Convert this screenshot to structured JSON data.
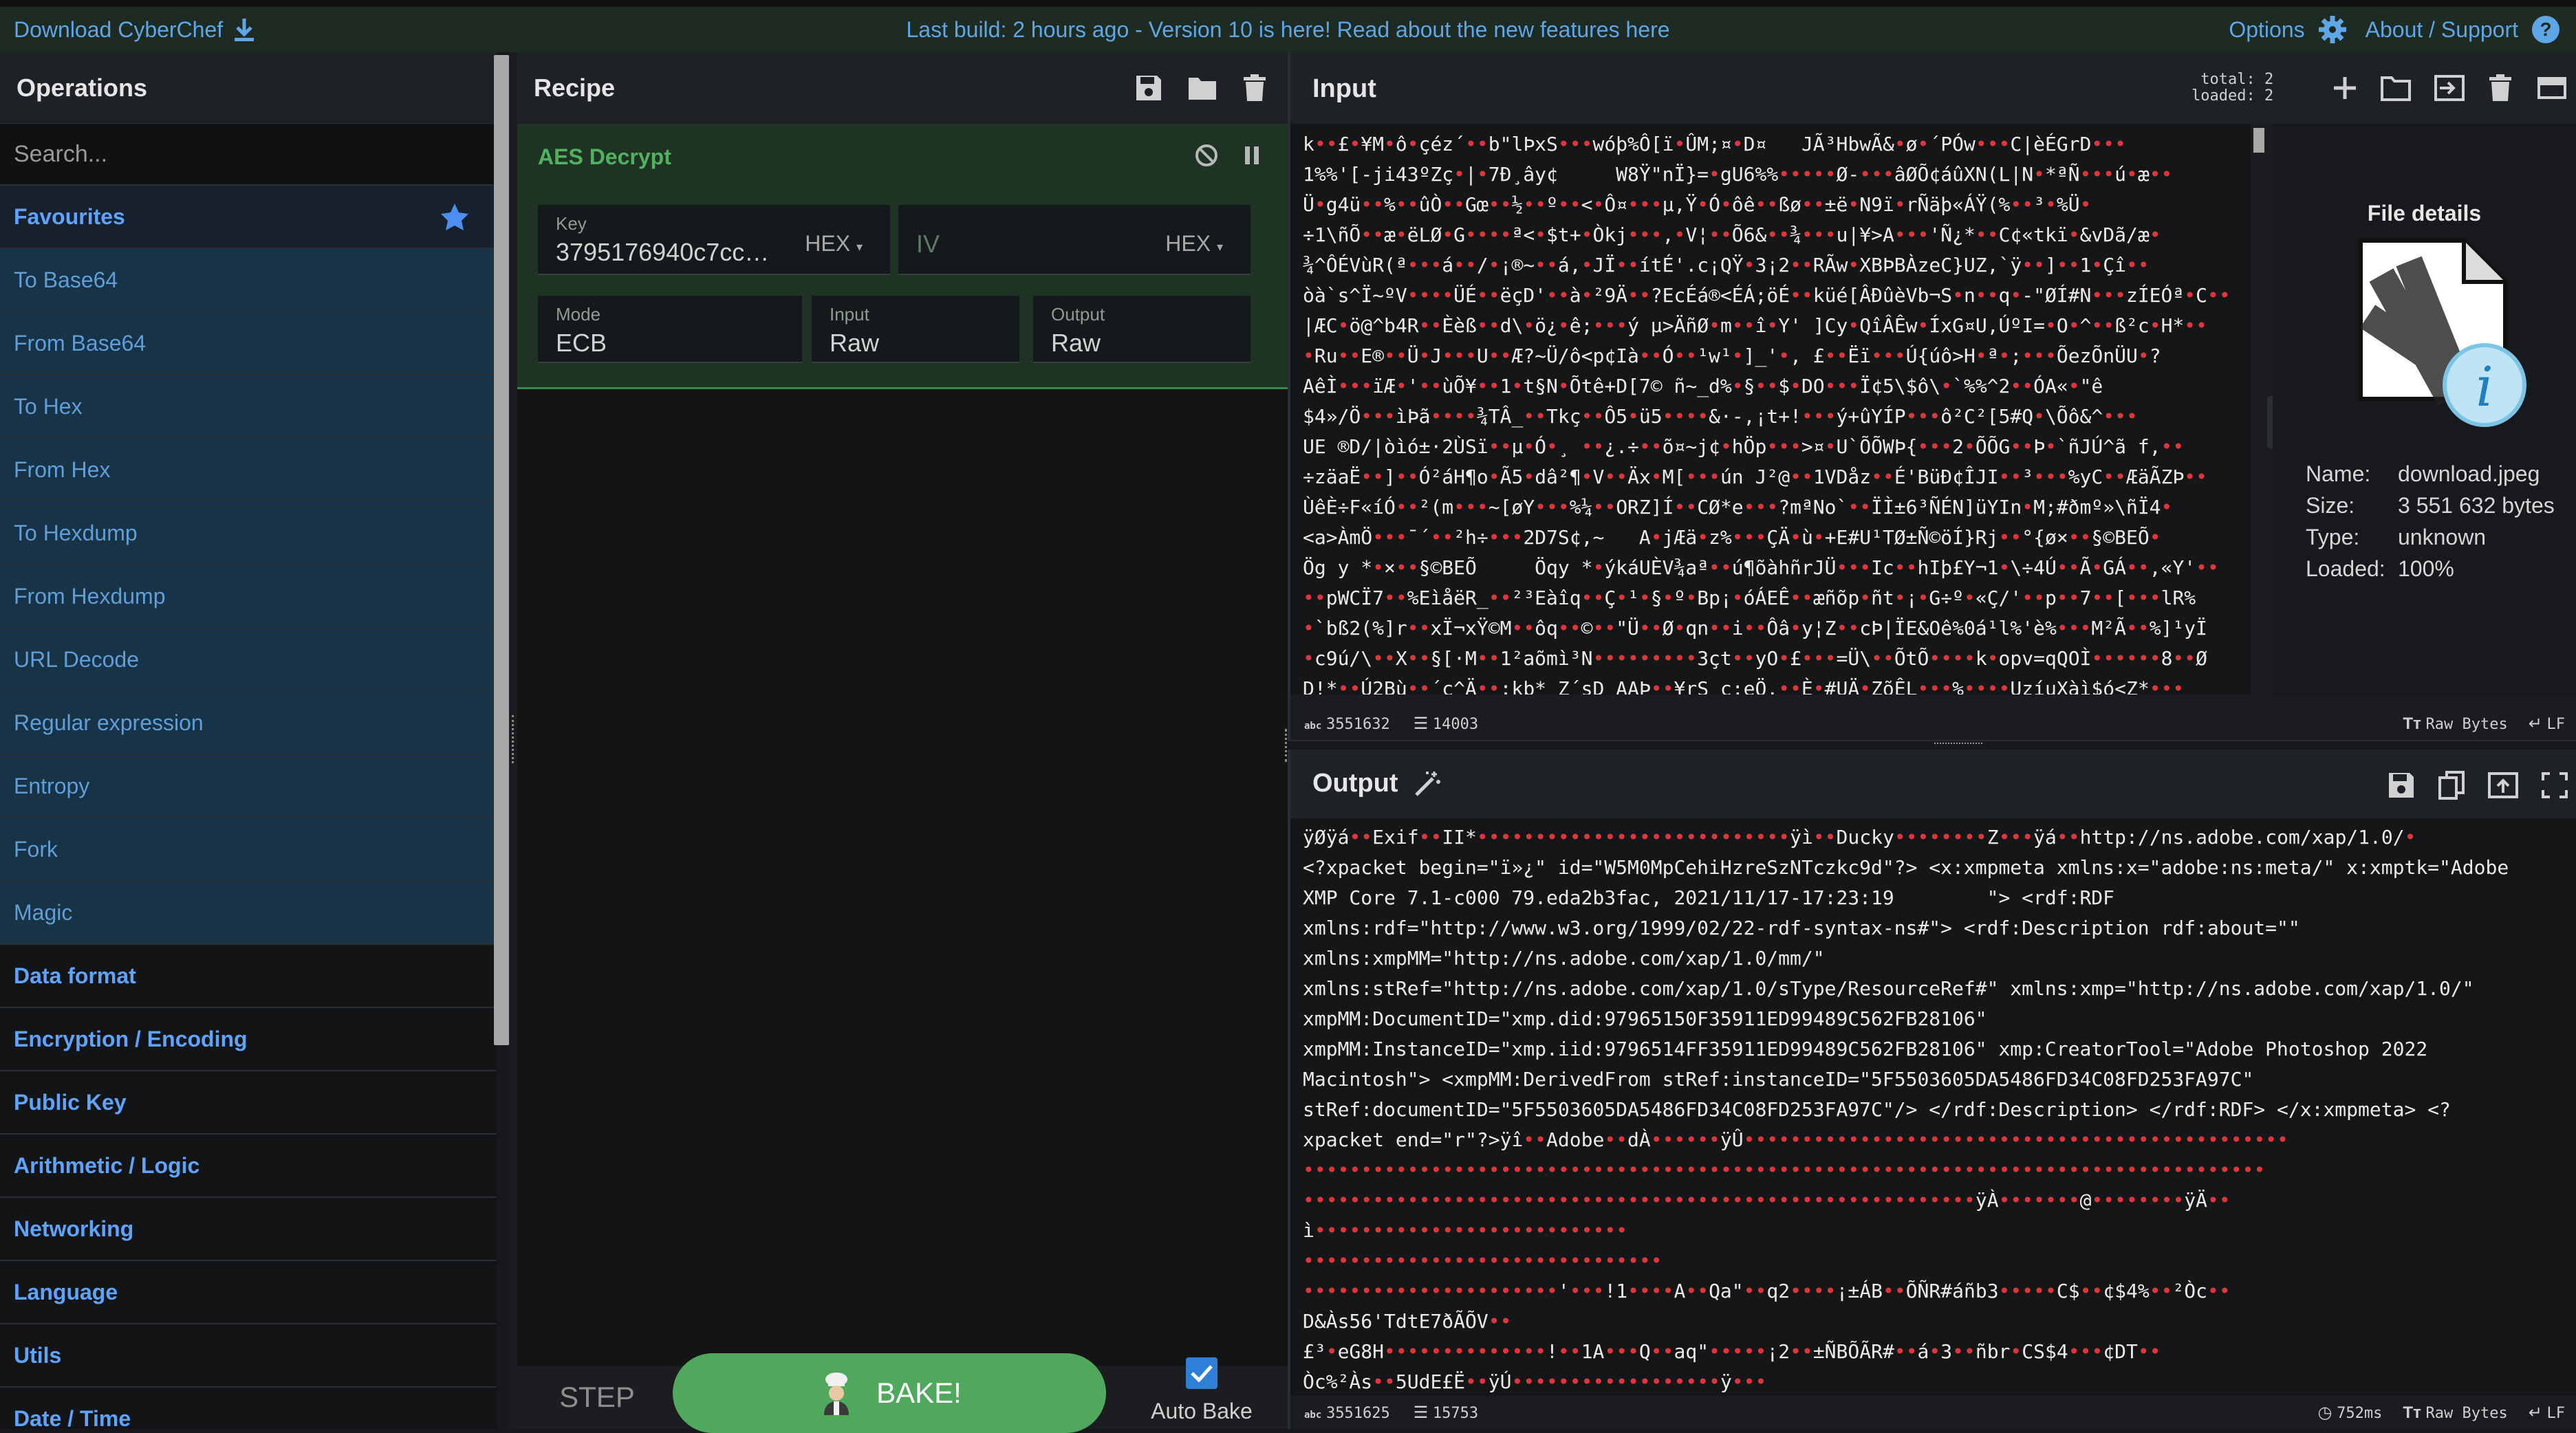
{
  "banner": {
    "download_label": "Download CyberChef",
    "last_build": "Last build: 2 hours ago - Version 10 is here! Read about the new features ",
    "here_link": "here",
    "options_label": "Options",
    "about_label": "About / Support"
  },
  "operations": {
    "title": "Operations",
    "search_placeholder": "Search...",
    "favourites_label": "Favourites",
    "favourites": [
      "To Base64",
      "From Base64",
      "To Hex",
      "From Hex",
      "To Hexdump",
      "From Hexdump",
      "URL Decode",
      "Regular expression",
      "Entropy",
      "Fork",
      "Magic"
    ],
    "categories": [
      "Data format",
      "Encryption / Encoding",
      "Public Key",
      "Arithmetic / Logic",
      "Networking",
      "Language",
      "Utils",
      "Date / Time"
    ]
  },
  "recipe": {
    "title": "Recipe",
    "operation": {
      "name": "AES Decrypt",
      "key_label": "Key",
      "key_value": "3795176940c7cc…",
      "key_format": "HEX",
      "iv_placeholder": "IV",
      "iv_format": "HEX",
      "mode_label": "Mode",
      "mode_value": "ECB",
      "input_label": "Input",
      "input_value": "Raw",
      "output_label": "Output",
      "output_value": "Raw"
    },
    "step_label": "STEP",
    "bake_label": "BAKE!",
    "autobake_label": "Auto Bake",
    "autobake_checked": true
  },
  "input": {
    "title": "Input",
    "total_label": "total:",
    "total_value": "2",
    "loaded_label": "loaded:",
    "loaded_value": "2",
    "lines": [
      "k••£•¥M•ô•çéz´••b\"lÞxS•••wóþ%Ô[ï•ÛM;¤•D¤   JÃ³HbwÃ&•ø•´PÓw•••C|èÉGrD•••",
      "1%%'[-ji43ºZç•|•7Ð¸ây¢     W8Ÿ\"nÏ}=•gU6%%•••••Ø-•••âØÕ¢áûXN(L|N•*ªÑ•••ú•æ••",
      "Ü•g4ü••%••ûÒ••Gœ••½••º••<•Ô¤•••µ,Ÿ•Ó•ôê••ßø••±ë•N9ï•rÑäþ«ÁŸ(%••³•%Ü•",
      "÷1\\ñÕ••æ•ëLØ•G••••ª<•$t+•Òkj•••,•V¦••Õ6&••¾•••u|¥>A•••'Ñ¿*••C¢«tkï•&vDã/æ•",
      "¾^ÔÉVùR(ª•••á••/•¡®~••á,•JÏ••ítÉ'.c¡QŸ•3¡2••RÃw•XBÞBÀzeC}UZ,`ÿ••]••1•Çî••",
      "òà`s^Ï~ºV••••ÜÉ••ëçD'••à•²9Ä••?EcÉá®<ÉÁ;öÉ••küé[ÂÐûèVb¬S•n••q•-\"ØÍ#N•••zÍEÓª•C••",
      "|ÆC•ö@^b4R••Èèß••d\\•ö¿•ê;•••ý µ>ÄñØ•m••î•Y' ]Cy•QîÂÊw•ÍxG¤U,ÚºI=•O•^••ß²c•H*••",
      "•Ru••E®••Ü•J•••U••Æ?~Ü/ô<p¢Ià••Ó••¹w¹•]_'•, £••Ëï•••Ú{úô>H•ª•;•••ÕezÕnÜU•?",
      "AêÌ•••ïÆ•'••ùÕ¥••1•t§N•Õtê+D[7© ñ~_d%•§••$•DO•••Ï¢5\\$ô\\•`%%^2••ÓA«•\"ê",
      "$4»/Ö•••ìÞã••••¾TÂ_••Tkç••Ô5•ü5••••&·-,¡t+!•••ý+ûYÍP•••ô²C²[5#Q•\\Õô&^•••",
      "UE ®D/|òìó±·2ÙSï••µ•Ó•¸ ••¿.÷••õ¤~j¢•hÖp•••>¤•U`ÕÕWÞ{•••2•ÕÕG••Þ•`ñJÚ^ã f,••",
      "÷zäaË••]••Ó²áH¶o•Ã5•dâ²¶•V••Äx•M[•••ún J²@••1VDåz••É'BüÐ¢ÎJI••³•••%yC••ÆäÃZÞ••",
      "ÙêÈ÷F«íÓ••²(m•••~[øY•••%¼••ORZ]Í••CØ*e•••?mªNo`••ÏÌ±6³ÑÉN]üYIn•M;#ðmº»\\ñÏ4•",
      "<a>ÀmÖ•••¯´••²h÷•••2D7S¢,~   A•jÆä•z%•••ÇÄ•ù•+E#U¹TØ±Ñ©öÍ}Rj••°{ø×••§©BEÕ•",
      "Ög y *•×••§©BEÕ     Öqy *•ýkáUÈV¾aª••ú¶õàhñrJÜ•••Ic••hIþ£Y¬1•\\÷4Ú••Ã•GÁ••,«Y'••",
      "••pWCÏ7••%EìåëR_••²³Eàîq••Ç•¹•§•º•Bp¡•óÁEÊ••æñõp•ñt•¡•G÷º•«Ç/'••p••7••[•••lR%",
      "•`bß2(%]r••xÏ¬xŸ©M••ôq••©••\"Ü••Ø•qn••i••Ôâ•y¦Z••cÞ|ÏE&Oê%0á¹l%'è%•••M²Ã••%]¹yÏ",
      "•c9ú/\\••X••§[·M••1²aõmì³N•••••••••3çt••yO•£•••=Ü\\••ÕtÕ••••k•opv=qQOÌ••••••8••Ø     ••",
      "D!*••Ú2Bù••´ç^Ä••:kb* Z´sD AAÞ••¥rS ç;eÖ.••È•#UÄ•ZõÊL•••%••••UzíuXàì$ó<Z*•••"
    ],
    "file": {
      "title": "File details",
      "name_label": "Name:",
      "name_value": "download.jpeg",
      "size_label": "Size:",
      "size_value": "3 551 632 bytes",
      "type_label": "Type:",
      "type_value": "unknown",
      "loaded_label": "Loaded:",
      "loaded_value": "100%"
    },
    "status": {
      "length_label": "abc",
      "length_value": "3551632",
      "lines_value": "14003",
      "encoding_label": "Raw Bytes",
      "eol_label": "LF"
    }
  },
  "output": {
    "title": "Output",
    "lines": [
      "ÿØÿá••Exif••II*•••••••••••••••••••••••••••ÿì••Ducky••••••••Z•••ÿá••http://ns.adobe.com/xap/1.0/•",
      "<?xpacket begin=\"ï»¿\" id=\"W5M0MpCehiHzreSzNTczkc9d\"?> <x:xmpmeta xmlns:x=\"adobe:ns:meta/\" x:xmptk=\"Adobe",
      "XMP Core 7.1-c000 79.eda2b3fac, 2021/11/17-17:23:19        \"> <rdf:RDF",
      "xmlns:rdf=\"http://www.w3.org/1999/02/22-rdf-syntax-ns#\"> <rdf:Description rdf:about=\"\"",
      "xmlns:xmpMM=\"http://ns.adobe.com/xap/1.0/mm/\"",
      "xmlns:stRef=\"http://ns.adobe.com/xap/1.0/sType/ResourceRef#\" xmlns:xmp=\"http://ns.adobe.com/xap/1.0/\"",
      "xmpMM:DocumentID=\"xmp.did:97965150F35911ED99489C562FB28106\"",
      "xmpMM:InstanceID=\"xmp.iid:9796514FF35911ED99489C562FB28106\" xmp:CreatorTool=\"Adobe Photoshop 2022",
      "Macintosh\"> <xmpMM:DerivedFrom stRef:instanceID=\"5F5503605DA5486FD34C08FD253FA97C\"",
      "stRef:documentID=\"5F5503605DA5486FD34C08FD253FA97C\"/> </rdf:Description> </rdf:RDF> </x:xmpmeta> <?",
      "xpacket end=\"r\"?>ÿî••Adobe••dÀ••••••ÿÛ•••••••••••••••••••••••••••••••••••••••••••••••",
      "•••••••••••••••••••••••••••••••••••••••••••••••••••••••••••••••••••••••••••••••••••",
      "••••••••••••••••••••••••••••••••••••••••••••••••••••••••••ÿÀ•••••••@••••••••ÿÄ••",
      "ì•••••••••••••••••••••••••••",
      "•••••••••••••••••••••••••••••••",
      "••••••••••••••••••••••'•••!1••••A••Qa\"••q2••••¡±ÁB••ÕÑR#áñb3•••••C$••¢$4%••²Òc••",
      "D&Às56'TdtE7ðÃÕV••",
      "£³•eG8H••••••••••••••!••1A•••Q••aq\"•••••¡2••±ÑBÕÃR#••á•3••ñbr•CS$4•••¢DT••",
      "Òc%²Às••5UdE£Ë••ÿÚ••••••••••••••••••ÿ•••"
    ],
    "status": {
      "length_label": "abc",
      "length_value": "3551625",
      "lines_value": "15753",
      "time_value": "752ms",
      "encoding_label": "Raw Bytes",
      "eol_label": "LF"
    }
  },
  "colors": {
    "accent_blue": "#5ea4ff",
    "bake_green": "#4fa85c",
    "control_char_red": "#e0353b"
  }
}
